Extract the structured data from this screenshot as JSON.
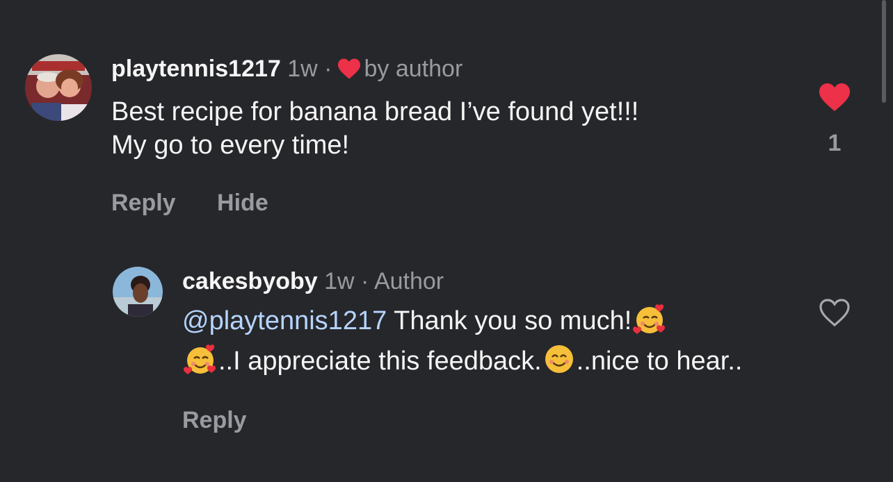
{
  "colors": {
    "background": "#26272b",
    "text": "#f5f5f5",
    "muted": "#9a9ba0",
    "mention": "#b6d4ff",
    "like_red": "#ed3148"
  },
  "comments": [
    {
      "username": "playtennis1217",
      "time": "1w",
      "separator": "·",
      "liked_by_author_text": "by author",
      "text_lines": [
        "Best recipe for banana bread I’ve found yet!!!",
        "My go to every time!"
      ],
      "actions": [
        "Reply",
        "Hide"
      ],
      "liked": true,
      "like_count": "1",
      "icons": {
        "inline": "heart-filled-icon",
        "like": "heart-filled-icon"
      }
    },
    {
      "username": "cakesbyoby",
      "time": "1w",
      "separator": "·",
      "role": "Author",
      "mention": "@playtennis1217",
      "text_part1": " Thank you so much!",
      "text_part2": "..I appreciate this feedback.",
      "text_part3": "..nice to hear..",
      "emojis": [
        "smiling-face-with-hearts",
        "smiling-face-with-hearts",
        "smiling-face"
      ],
      "actions": [
        "Reply"
      ],
      "liked": false,
      "icons": {
        "like": "heart-outline-icon"
      }
    }
  ]
}
